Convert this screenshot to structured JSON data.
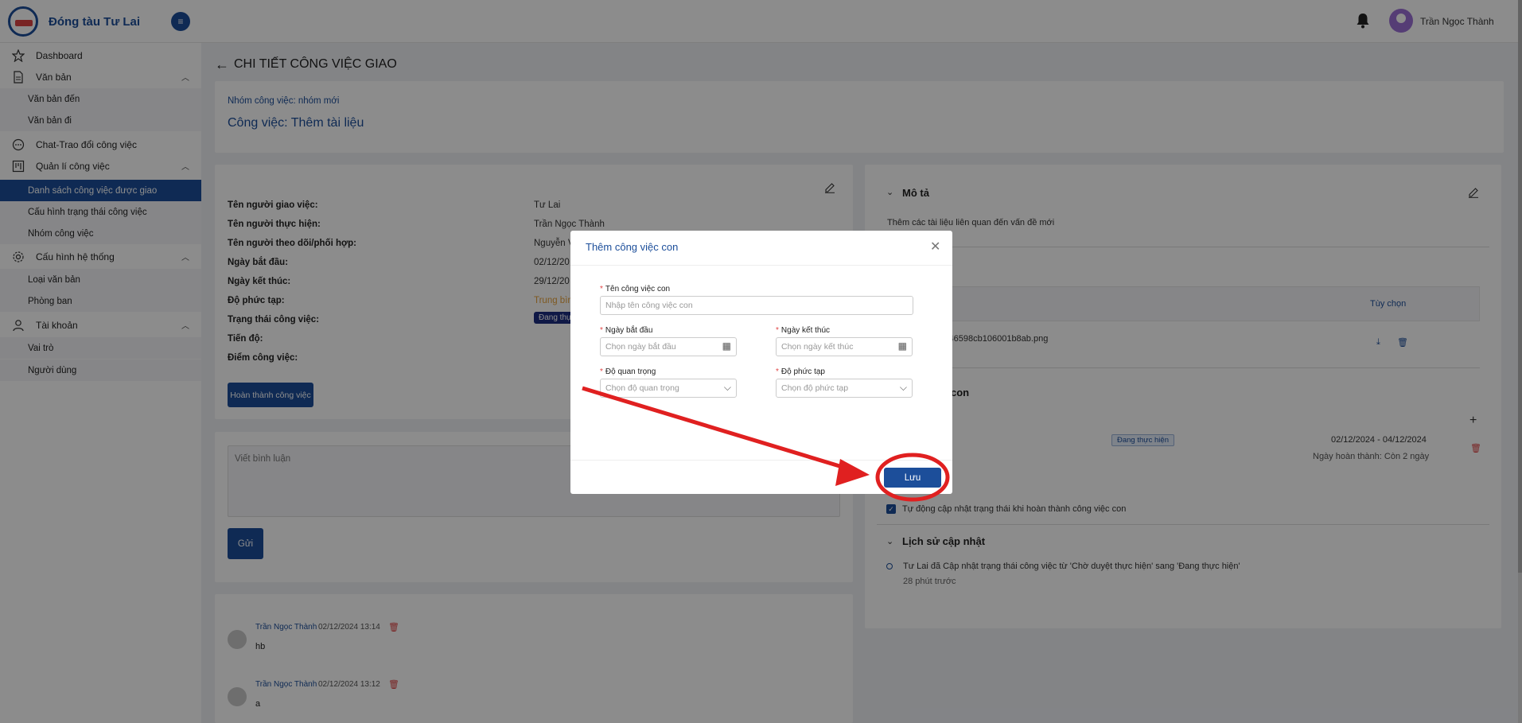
{
  "header": {
    "app_name": "Đóng tàu Tư Lai",
    "user_name": "Trần Ngọc Thành"
  },
  "sidebar": {
    "dashboard": "Dashboard",
    "van_ban": "Văn bản",
    "van_ban_den": "Văn bản đến",
    "van_ban_di": "Văn bản đi",
    "chat": "Chat-Trao đổi công việc",
    "quan_li": "Quản lí công việc",
    "ds_cong_viec": "Danh sách công việc được giao",
    "cau_hinh_trang_thai": "Cấu hình trạng thái công việc",
    "nhom_cong_viec": "Nhóm công việc",
    "cau_hinh_he_thong": "Cấu hình hệ thống",
    "loai_van_ban": "Loại văn bản",
    "phong_ban": "Phòng ban",
    "tai_khoan": "Tài khoản",
    "vai_tro": "Vai trò",
    "nguoi_dung": "Người dùng"
  },
  "page": {
    "title": "CHI TIẾT CÔNG VIỆC GIAO",
    "group_label": "Nhóm công việc: nhóm mới",
    "task_title": "Công việc: Thêm tài liệu"
  },
  "info": {
    "labels": {
      "giao": "Tên người giao việc:",
      "thuc_hien": "Tên người thực hiện:",
      "theo_doi": "Tên người theo dõi/phối hợp:",
      "bat_dau": "Ngày bắt đầu:",
      "ket_thuc": "Ngày kết thúc:",
      "phuc_tap": "Độ phức tạp:",
      "trang_thai": "Trạng thái công việc:",
      "tien_do": "Tiến độ:",
      "diem": "Điểm công việc:"
    },
    "values": {
      "giao": "Tư Lai",
      "thuc_hien": "Trần Ngọc Thành",
      "theo_doi": "Nguyễn V",
      "bat_dau": "02/12/20",
      "ket_thuc": "29/12/20",
      "phuc_tap": "Trung bìn",
      "trang_thai": "Đang thự"
    },
    "complete_button": "Hoàn thành công việc"
  },
  "comments": {
    "placeholder": "Viết bình luận",
    "send": "Gửi",
    "items": [
      {
        "author": "Trần Ngọc Thành",
        "time": "02/12/2024 13:14",
        "text": "hb"
      },
      {
        "author": "Trần Ngọc Thành",
        "time": "02/12/2024 13:12",
        "text": "a"
      }
    ]
  },
  "right": {
    "mo_ta_title": "Mô tả",
    "mo_ta_text": "Thêm các tài liệu liên quan đến vấn đề mới",
    "tuy_chon": "Tùy chọn",
    "file_name": "f49d246598cb106001b8ab.png",
    "subtasks_title_partial": "con",
    "subtask_status": "Đang thực hiện",
    "subtask_dates": "02/12/2024 - 04/12/2024",
    "subtask_remaining": "Ngày hoàn thành: Còn 2 ngày",
    "auto_update": "Tự động cập nhật trạng thái khi hoàn thành công việc con",
    "history_title": "Lịch sử cập nhật",
    "history_text": "Tư Lai đã Cập nhật trạng thái công việc từ 'Chờ duyệt thực hiện' sang 'Đang thực hiện'",
    "history_time": "28 phút trước"
  },
  "modal": {
    "title": "Thêm công việc con",
    "name_label": "Tên công việc con",
    "name_placeholder": "Nhập tên công việc con",
    "start_label": "Ngày bắt đầu",
    "start_placeholder": "Chọn ngày bắt đầu",
    "end_label": "Ngày kết thúc",
    "end_placeholder": "Chọn ngày kết thúc",
    "importance_label": "Độ quan trọng",
    "importance_placeholder": "Chọn độ quan trọng",
    "complexity_label": "Độ phức tạp",
    "complexity_placeholder": "Chọn độ phức tạp",
    "save": "Lưu"
  },
  "colors": {
    "primary": "#1c4e9a",
    "annotation": "#e02020",
    "status_tag": "#1c2d80"
  }
}
